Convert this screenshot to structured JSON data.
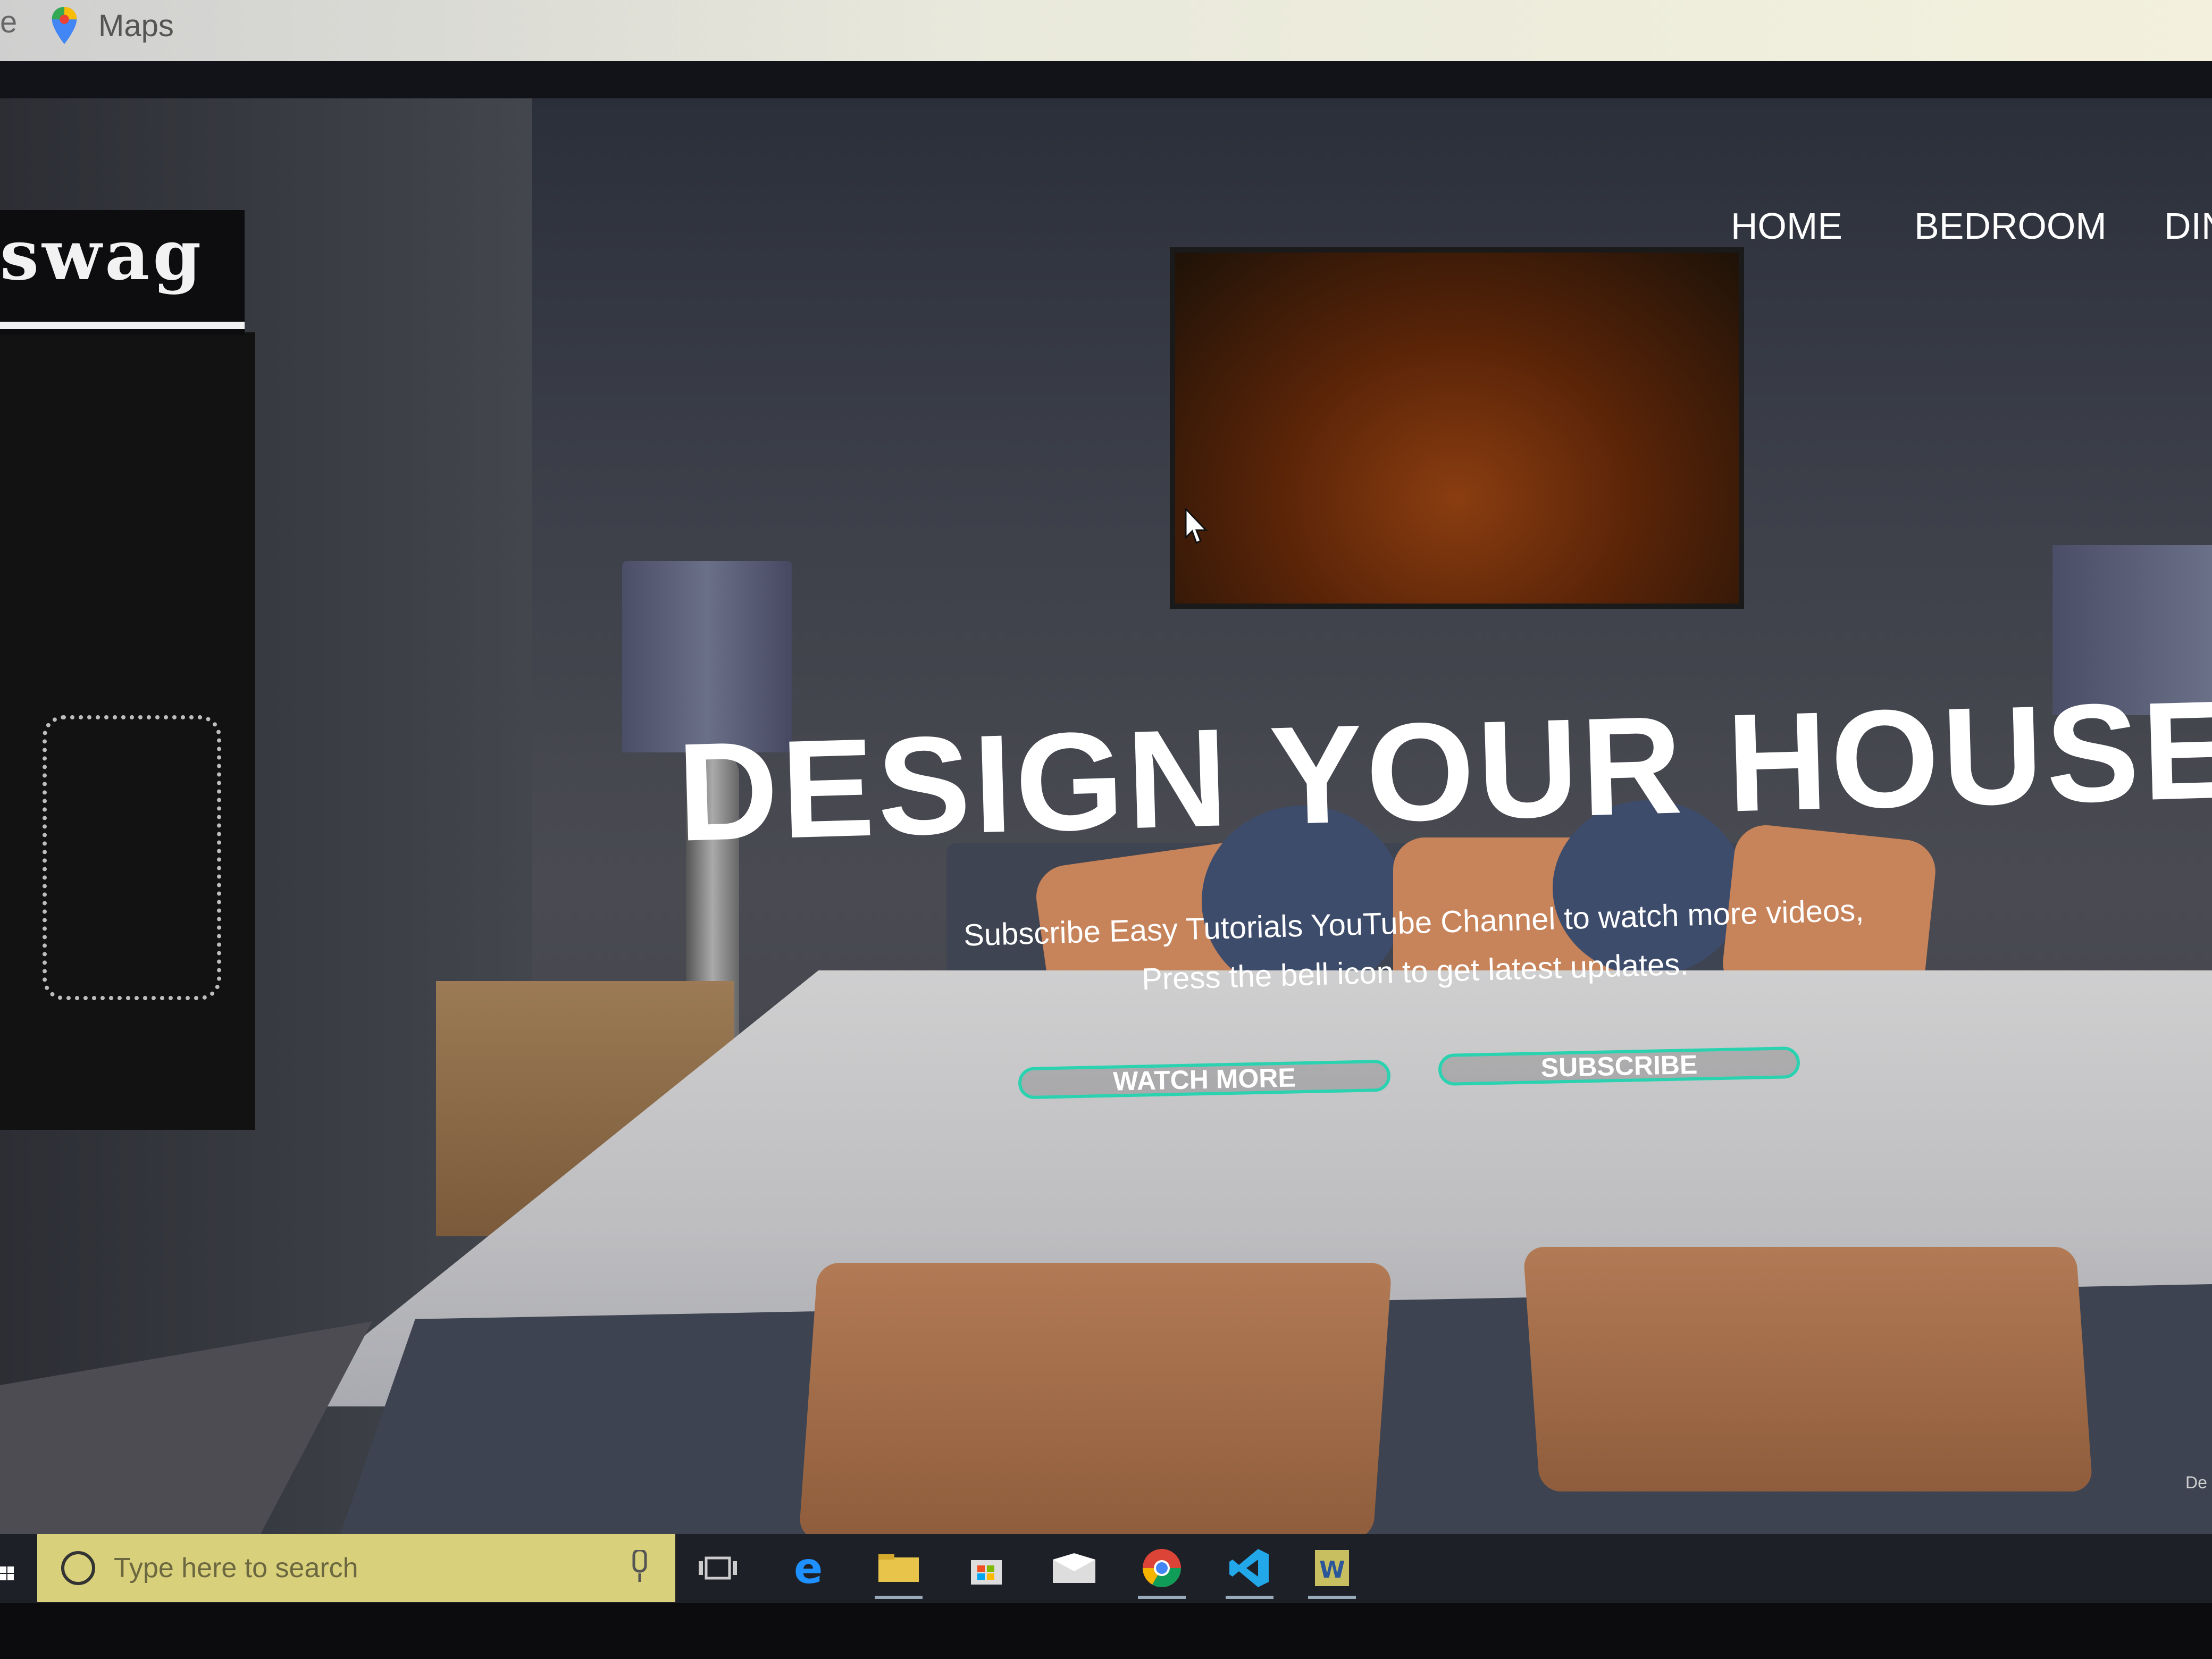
{
  "browser": {
    "bookmarks": [
      {
        "label": "e",
        "icon": "edge-partial"
      },
      {
        "label": "Maps",
        "icon": "maps-pin-icon"
      }
    ]
  },
  "site": {
    "logo_text": "swag",
    "nav": [
      "HOME",
      "BEDROOM",
      "DIN"
    ],
    "hero": {
      "title": "DESIGN YOUR HOUSE",
      "subtitle_line1": "Subscribe Easy Tutorials YouTube Channel to watch more videos,",
      "subtitle_line2": "Press the bell icon to get latest updates.",
      "buttons": [
        "WATCH MORE",
        "SUBSCRIBE"
      ],
      "button_border_color": "#2ad2b0",
      "partial_corner_text": "De"
    }
  },
  "taskbar": {
    "search_placeholder": "Type here to search",
    "icons": [
      "task-view-icon",
      "edge-icon",
      "file-explorer-icon",
      "store-icon",
      "mail-icon",
      "chrome-icon",
      "vscode-icon",
      "word-icon"
    ]
  }
}
